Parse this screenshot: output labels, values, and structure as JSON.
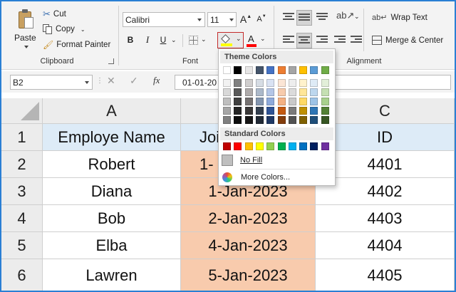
{
  "clipboard": {
    "paste_label": "Paste",
    "cut_label": "Cut",
    "copy_label": "Copy",
    "format_painter_label": "Format Painter",
    "group_label": "Clipboard"
  },
  "font": {
    "name": "Calibri",
    "size": "11",
    "group_label": "Font",
    "grow_label": "A",
    "shrink_label": "A",
    "bold_label": "B",
    "italic_label": "I",
    "underline_label": "U",
    "font_color_label": "A"
  },
  "alignment": {
    "wrap_text_label": "Wrap Text",
    "merge_label": "Merge & Center",
    "group_label": "Alignment"
  },
  "formula_bar": {
    "name_box": "B2",
    "fx_label": "fx",
    "content": "01-01-20"
  },
  "fill_dropdown": {
    "theme_colors_label": "Theme Colors",
    "standard_colors_label": "Standard Colors",
    "no_fill_label": "No Fill",
    "more_colors_label": "More Colors...",
    "theme_top": [
      "#ffffff",
      "#000000",
      "#e7e6e6",
      "#44546a",
      "#4472c4",
      "#ed7d31",
      "#a5a5a5",
      "#ffc000",
      "#5b9bd5",
      "#70ad47"
    ],
    "theme_shades": [
      [
        "#f2f2f2",
        "#d9d9d9",
        "#bfbfbf",
        "#a6a6a6",
        "#808080"
      ],
      [
        "#808080",
        "#595959",
        "#404040",
        "#262626",
        "#0d0d0d"
      ],
      [
        "#d0cece",
        "#aeaaaa",
        "#757171",
        "#3a3838",
        "#171616"
      ],
      [
        "#d6dce4",
        "#acb9ca",
        "#8496b0",
        "#333f4f",
        "#222a35"
      ],
      [
        "#d9e2f3",
        "#b4c6e7",
        "#8eaadb",
        "#2f5496",
        "#1f3864"
      ],
      [
        "#fbe5d5",
        "#f7cbac",
        "#f4b183",
        "#c55a11",
        "#833c0b"
      ],
      [
        "#ededed",
        "#dbdbdb",
        "#c9c9c9",
        "#7b7b7b",
        "#525252"
      ],
      [
        "#fff2cc",
        "#ffe699",
        "#ffd966",
        "#bf9000",
        "#7f6000"
      ],
      [
        "#deebf6",
        "#bdd7ee",
        "#9dc3e6",
        "#2e75b5",
        "#1f4e79"
      ],
      [
        "#e2efd9",
        "#c5e0b3",
        "#a8d08d",
        "#538135",
        "#375623"
      ]
    ],
    "standard": [
      "#c00000",
      "#ff0000",
      "#ffc000",
      "#ffff00",
      "#92d050",
      "#00b050",
      "#00b0f0",
      "#0070c0",
      "#002060",
      "#7030a0"
    ]
  },
  "sheet": {
    "columns": [
      "A",
      "B",
      "C"
    ],
    "rows": [
      "1",
      "2",
      "3",
      "4",
      "5",
      "6"
    ],
    "header_row": {
      "a": "Employe Name",
      "b": "Joi",
      "c": "ID"
    },
    "data": [
      {
        "a": "Robert",
        "b": "1-",
        "c": "4401"
      },
      {
        "a": "Diana",
        "b": "1-Jan-2023",
        "c": "4402"
      },
      {
        "a": "Bob",
        "b": "2-Jan-2023",
        "c": "4403"
      },
      {
        "a": "Elba",
        "b": "4-Jan-2023",
        "c": "4404"
      },
      {
        "a": "Lawren",
        "b": "5-Jan-2023",
        "c": "4405"
      }
    ],
    "colors": {
      "header_fill": "#ddebf7",
      "date_fill": "#f8cbad",
      "grid": "#cfcfcf"
    }
  }
}
